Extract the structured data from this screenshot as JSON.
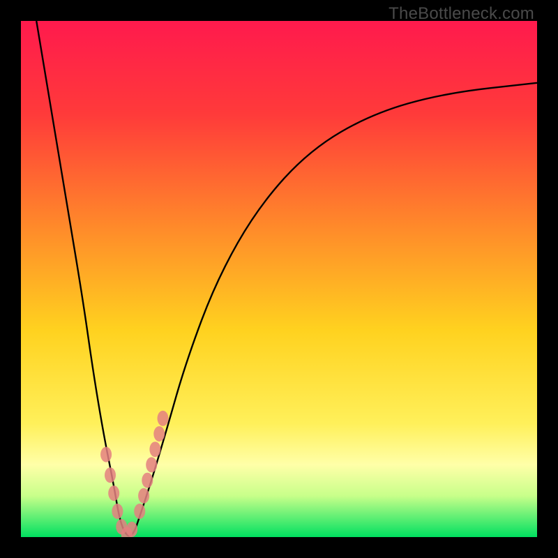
{
  "watermark": "TheBottleneck.com",
  "colors": {
    "frame": "#000000",
    "curve": "#000000",
    "marker": "#e48080",
    "gradient_stops": [
      {
        "pct": 0,
        "color": "#ff1a4d"
      },
      {
        "pct": 18,
        "color": "#ff3a3a"
      },
      {
        "pct": 40,
        "color": "#ff8a2a"
      },
      {
        "pct": 60,
        "color": "#ffd21f"
      },
      {
        "pct": 78,
        "color": "#fff05a"
      },
      {
        "pct": 86,
        "color": "#ffffa8"
      },
      {
        "pct": 92,
        "color": "#c8ff8a"
      },
      {
        "pct": 100,
        "color": "#00e060"
      }
    ]
  },
  "chart_data": {
    "type": "line",
    "title": "",
    "xlabel": "",
    "ylabel": "",
    "xlim": [
      0,
      100
    ],
    "ylim": [
      0,
      100
    ],
    "note": "V-shaped bottleneck curve; y≈0 near optimum, rising steeply on the left branch and asymptotically on the right. No axes or tick labels are rendered in the image, so values are estimated from pixel positions on a 0–100 normalized scale.",
    "series": [
      {
        "name": "bottleneck-curve",
        "x": [
          3,
          6,
          9,
          12,
          14,
          16,
          18,
          19,
          20,
          21,
          22,
          23,
          25,
          28,
          32,
          38,
          46,
          56,
          68,
          82,
          100
        ],
        "y": [
          100,
          82,
          64,
          46,
          32,
          20,
          10,
          4,
          1,
          0,
          1,
          4,
          10,
          20,
          34,
          50,
          64,
          75,
          82,
          86,
          88
        ]
      }
    ],
    "markers": {
      "name": "highlighted-points",
      "x": [
        16.5,
        17.3,
        18.0,
        18.7,
        19.5,
        20.5,
        21.5,
        23.0,
        23.8,
        24.5,
        25.3,
        26.0,
        26.8,
        27.5
      ],
      "y": [
        16.0,
        12.0,
        8.5,
        5.0,
        2.0,
        0.5,
        1.5,
        5.0,
        8.0,
        11.0,
        14.0,
        17.0,
        20.0,
        23.0
      ]
    }
  }
}
